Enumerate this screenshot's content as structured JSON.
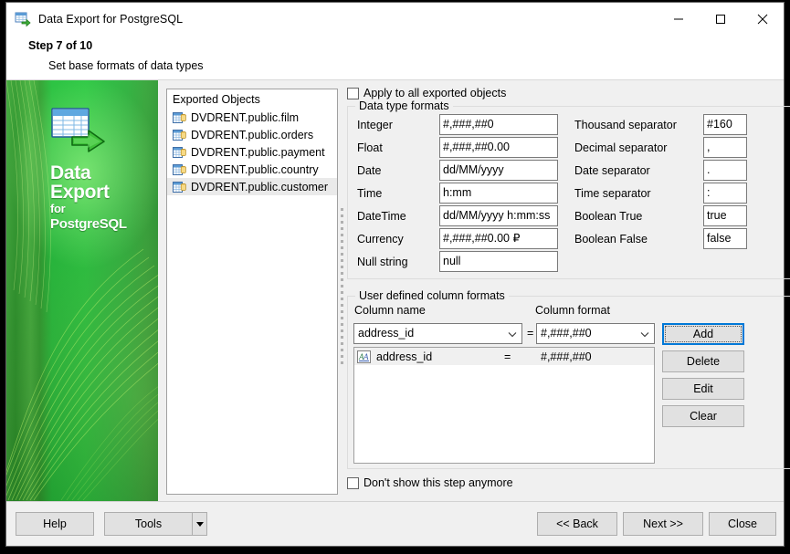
{
  "window": {
    "title": "Data Export for PostgreSQL",
    "icon": "data-export-icon",
    "minimize": "minimize-icon",
    "maximize": "maximize-icon",
    "close": "close-icon"
  },
  "header": {
    "step": "Step 7 of 10",
    "subtitle": "Set base formats of data types"
  },
  "banner": {
    "line1": "Data",
    "line2": "Export",
    "line3": "for",
    "line4": "PostgreSQL"
  },
  "objects": {
    "header": "Exported Objects",
    "items": [
      {
        "label": "DVDRENT.public.film",
        "selected": false
      },
      {
        "label": "DVDRENT.public.orders",
        "selected": false
      },
      {
        "label": "DVDRENT.public.payment",
        "selected": false
      },
      {
        "label": "DVDRENT.public.country",
        "selected": false
      },
      {
        "label": "DVDRENT.public.customer",
        "selected": true
      }
    ]
  },
  "apply_all": {
    "label": "Apply to all exported objects",
    "checked": false
  },
  "data_type_formats": {
    "legend": "Data type formats",
    "fields": [
      {
        "label": "Integer",
        "value": "#,###,##0"
      },
      {
        "label": "Float",
        "value": "#,###,##0.00"
      },
      {
        "label": "Date",
        "value": "dd/MM/yyyy"
      },
      {
        "label": "Time",
        "value": "h:mm"
      },
      {
        "label": "DateTime",
        "value": "dd/MM/yyyy h:mm:ss"
      },
      {
        "label": "Currency",
        "value": "#,###,##0.00 ₽"
      },
      {
        "label": "Null string",
        "value": "null"
      }
    ],
    "separators": [
      {
        "label": "Thousand separator",
        "value": "#160"
      },
      {
        "label": "Decimal separator",
        "value": ","
      },
      {
        "label": "Date separator",
        "value": "."
      },
      {
        "label": "Time separator",
        "value": ":"
      },
      {
        "label": "Boolean True",
        "value": "true"
      },
      {
        "label": "Boolean False",
        "value": "false"
      }
    ]
  },
  "user_formats": {
    "legend": "User defined column formats",
    "column_name_label": "Column name",
    "column_format_label": "Column format",
    "equals": "=",
    "column_name_value": "address_id",
    "column_format_value": "#,###,##0",
    "rows": [
      {
        "icon": "format-a-icon",
        "name": "address_id",
        "eq": "=",
        "format": "#,###,##0"
      }
    ],
    "buttons": [
      {
        "label": "Add",
        "focused": true
      },
      {
        "label": "Delete",
        "focused": false
      },
      {
        "label": "Edit",
        "focused": false
      },
      {
        "label": "Clear",
        "focused": false
      }
    ]
  },
  "dont_show": {
    "label": "Don't show this step anymore",
    "checked": false
  },
  "footer": {
    "help": "Help",
    "tools": "Tools",
    "back": "<< Back",
    "next": "Next >>",
    "close": "Close"
  },
  "colors": {
    "accent_green": "#24c63c",
    "focus_blue": "#0078d7",
    "window_bg": "#f0f0f0"
  }
}
